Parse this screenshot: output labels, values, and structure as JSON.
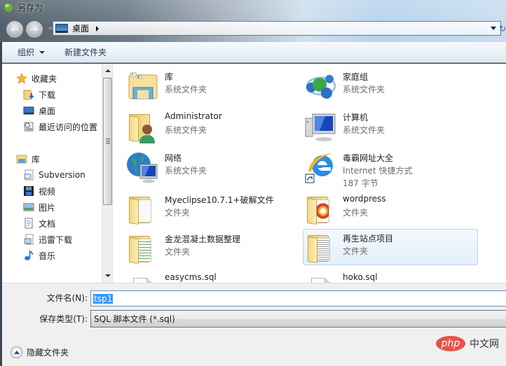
{
  "window": {
    "title": "另存为"
  },
  "address": {
    "location": "桌面"
  },
  "toolbar": {
    "organize_label": "组织",
    "new_folder_label": "新建文件夹"
  },
  "navpane": {
    "favorites": {
      "label": "收藏夹",
      "items": [
        {
          "label": "下载",
          "icon": "download-folder-icon"
        },
        {
          "label": "桌面",
          "icon": "desktop-icon"
        },
        {
          "label": "最近访问的位置",
          "icon": "recent-places-icon"
        }
      ]
    },
    "libraries": {
      "label": "库",
      "items": [
        {
          "label": "Subversion",
          "icon": "library-icon"
        },
        {
          "label": "视频",
          "icon": "video-icon"
        },
        {
          "label": "图片",
          "icon": "picture-icon"
        },
        {
          "label": "文档",
          "icon": "document-icon"
        },
        {
          "label": "迅雷下载",
          "icon": "library-icon"
        },
        {
          "label": "音乐",
          "icon": "music-icon"
        }
      ]
    }
  },
  "content": {
    "items": [
      {
        "name": "库",
        "sub": "系统文件夹",
        "icon": "libraries-icon"
      },
      {
        "name": "家庭组",
        "sub": "系统文件夹",
        "icon": "homegroup-icon"
      },
      {
        "name": "Administrator",
        "sub": "系统文件夹",
        "icon": "user-folder-icon"
      },
      {
        "name": "计算机",
        "sub": "系统文件夹",
        "icon": "computer-icon"
      },
      {
        "name": "网络",
        "sub": "系统文件夹",
        "icon": "network-icon"
      },
      {
        "name": "毒霸网址大全",
        "sub": "Internet 快捷方式",
        "sub2": "187 字节",
        "icon": "ie-shortcut-icon"
      },
      {
        "name": "Myeclipse10.7.1+破解文件",
        "sub": "文件夹",
        "icon": "folder-icon"
      },
      {
        "name": "wordpress",
        "sub": "文件夹",
        "icon": "folder-icon"
      },
      {
        "name": "金龙混凝土数据整理",
        "sub": "文件夹",
        "icon": "folder-icon"
      },
      {
        "name": "再生站点项目",
        "sub": "文件夹",
        "icon": "folder-icon",
        "selected": true
      },
      {
        "name": "easycms.sql",
        "icon": "sql-file-icon"
      },
      {
        "name": "hoko.sql",
        "icon": "sql-file-icon"
      }
    ]
  },
  "form": {
    "filename_label": "文件名(N):",
    "filename_value": "tsp1",
    "filetype_label": "保存类型(T):",
    "filetype_value": "SQL 脚本文件 (*.sql)",
    "hide_folders_label": "隐藏文件夹"
  },
  "watermark": {
    "logo": "php",
    "text": "中文网"
  }
}
